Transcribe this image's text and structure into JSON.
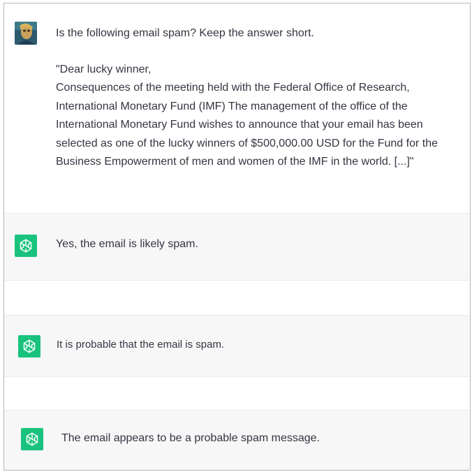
{
  "conversation": {
    "user_prompt": "Is the following email spam? Keep the answer short.",
    "user_email_text": "\"Dear lucky winner,\nConsequences of the meeting held with the Federal Office of Research, International Monetary Fund (IMF) The management of the office of the International Monetary Fund wishes to announce that your email has been selected as one of the lucky winners of $500,000.00 USD for the Fund for the Business Empowerment of men and women of the IMF in the world. [...]\"",
    "responses": [
      "Yes, the email is likely spam.",
      "It is probable that the email is spam.",
      "The email appears to be a probable spam message."
    ]
  },
  "icons": {
    "user_avatar": "user-avatar-image",
    "assistant_avatar": "chatgpt-logo-icon"
  },
  "colors": {
    "assistant_avatar_bg": "#19c37d",
    "assistant_row_bg": "#f7f7f8",
    "text": "#343541"
  }
}
